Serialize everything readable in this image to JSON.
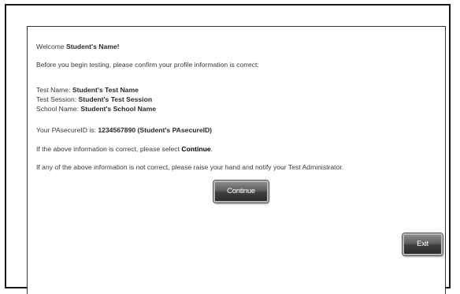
{
  "welcome": {
    "prefix": "Welcome ",
    "name": "Student's Name!"
  },
  "intro": "Before you begin testing, please confirm your profile information is correct:",
  "profile": {
    "test_name_label": "Test Name: ",
    "test_name_value": "Student's Test Name",
    "test_session_label": "Test Session: ",
    "test_session_value": "Student's Test Session",
    "school_name_label": "School Name: ",
    "school_name_value": "Student's School Name"
  },
  "secure_id": {
    "label": "Your PAsecureID is: ",
    "value": "1234567890 (Student's PAsecureID)"
  },
  "confirm": {
    "prefix": "If the above information is correct, please select ",
    "action": "Continue",
    "suffix": "."
  },
  "notify": "If any of the above information is not correct, please raise your hand and notify your Test Administrator.",
  "buttons": {
    "continue_label": "Continue",
    "exit_label": "Exit"
  }
}
